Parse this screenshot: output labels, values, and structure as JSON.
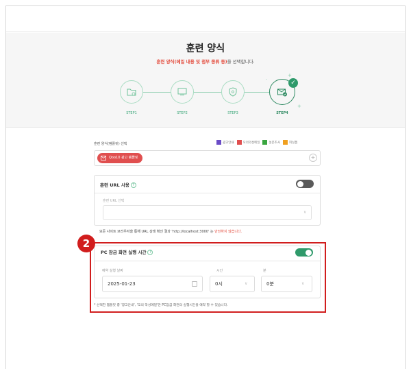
{
  "page": {
    "title": "훈련 양식",
    "subtitle_highlight": "훈련 양식(메일 내용 및 첨부 종류 등)",
    "subtitle_rest": "을 선택합니다."
  },
  "steps": [
    {
      "label": "STEP1",
      "icon": "folder-icon"
    },
    {
      "label": "STEP2",
      "icon": "monitor-icon"
    },
    {
      "label": "STEP3",
      "icon": "shield-icon"
    },
    {
      "label": "STEP4",
      "icon": "mail-check-icon"
    }
  ],
  "template": {
    "label": "훈련 양식(템플릿) 선택",
    "legend": [
      "광고안내",
      "모의악성메일",
      "설문조사",
      "피싱폼"
    ],
    "selected_chip": "Qoo10 광고 템플릿"
  },
  "url_section": {
    "title": "훈련 URL 사용",
    "toggle": "off",
    "select_label": "훈련 URL 선택",
    "notice_prefix": "모든 사이트 브라우저을 통해 URL 상태 확인 결과 'http://localhost:3000' 는",
    "notice_status": "안전하지 않습니다."
  },
  "callout": {
    "number": "2"
  },
  "pc_section": {
    "title": "PC 잠금 화면 실행 시간",
    "toggle": "on",
    "date_label": "예약 실행 날짜",
    "date_value": "2025-01-23",
    "hour_label": "시간",
    "hour_value": "0시",
    "minute_label": "분",
    "minute_value": "0분",
    "footnote": "* 선택한 템플릿 중 '광고안내', '모의 악성메일'만 PC잠금 화면의 실행시간을 예약 할 수 있습니다."
  },
  "colors": {
    "accent_green": "#2f9a6b",
    "accent_red": "#e34a3b",
    "highlight_red": "#d11d1d"
  }
}
